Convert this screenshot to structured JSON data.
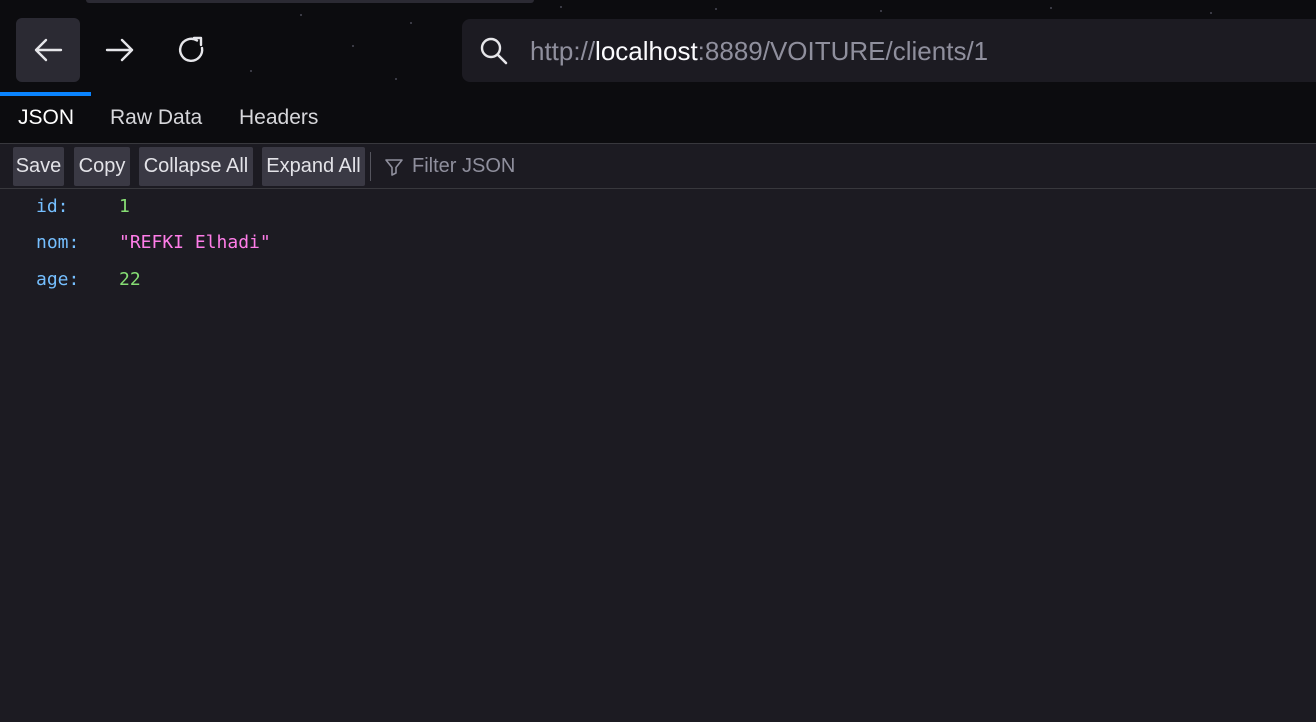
{
  "browser": {
    "url_scheme": "http://",
    "url_host": "localhost",
    "url_rest": ":8889/VOITURE/clients/1",
    "icons": {
      "back": "arrow-left-icon",
      "forward": "arrow-right-icon",
      "reload": "reload-icon",
      "search": "search-icon"
    }
  },
  "viewer_tabs": [
    {
      "label": "JSON",
      "active": true
    },
    {
      "label": "Raw Data",
      "active": false
    },
    {
      "label": "Headers",
      "active": false
    }
  ],
  "json_toolbar": {
    "save_label": "Save",
    "copy_label": "Copy",
    "collapse_label": "Collapse All",
    "expand_label": "Expand All",
    "filter_placeholder": "Filter JSON",
    "filter_icon": "filter-icon"
  },
  "json_rows": [
    {
      "key": "id:",
      "value": "1",
      "type": "number"
    },
    {
      "key": "nom:",
      "value": "\"REFKI Elhadi\"",
      "type": "string"
    },
    {
      "key": "age:",
      "value": "22",
      "type": "number"
    }
  ],
  "colors": {
    "accent": "#0a84ff",
    "key": "#75bfff",
    "number": "#86de74",
    "string": "#ff7de9",
    "background": "#1c1b22",
    "toolbar_bg": "#0c0c0f"
  }
}
